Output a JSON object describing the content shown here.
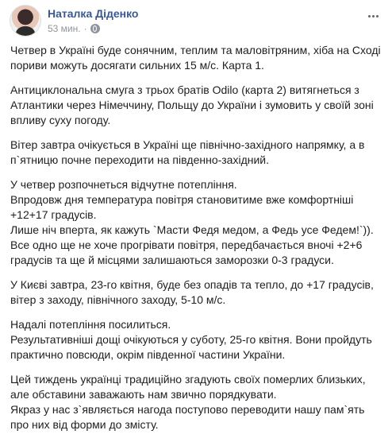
{
  "post": {
    "author": "Наталка Діденко",
    "time": "53 мин.",
    "dot": "·",
    "paragraphs": [
      [
        "Четвер в Україні буде сонячним, теплим та маловітряним, хіба на Сході пориви можуть досягати сильних 15 м/с. Карта 1."
      ],
      [
        "Антициклональна смуга з трьох братів Odilo (карта 2) витягнеться з Атлантики через Німеччину, Польщу до України і зумовить у своїй зоні впливу суху погоду."
      ],
      [
        "Вітер завтра очікується в Україні ще північно-західного напрямку, а в п`ятницю почне переходити на південно-західний."
      ],
      [
        "У четвер розпочнеться відчутне потепління.",
        "Впродовж дня температура повітря становитиме вже комфортніші +12+17 градусів.",
        "Лише ніч вперта, як кажуть `Масти Федя медом, а Федь усе Федем!`)).",
        "Все одно ще не хоче прогрівати повітря, передбачається вночі +2+6 градусів та ще й місцями залишаються заморозки 0-3 градуси."
      ],
      [
        "У Києві завтра, 23-го квітня, буде без опадів та тепло, до +17 градусів, вітер з заходу, північного заходу, 5-10 м/с."
      ],
      [
        "Надалі потепління посилиться.",
        "Результативніші дощі очікуються у суботу, 25-го квітня. Вони пройдуть практично повсюди, окрім південної частини України."
      ],
      [
        "Цей тиждень українці традиційно згадують своїх померлих близьких, але обставини заважають нам звично порядкувати.",
        "Якраз у нас з`являється нагода поступово переводити нашу пам`ять про них від форми до змісту."
      ]
    ]
  },
  "icons": {
    "privacy": "globe-icon",
    "options": "more-options-icon"
  },
  "colors": {
    "author": "#385898",
    "text": "#1c1e21",
    "meta": "#90949c"
  }
}
